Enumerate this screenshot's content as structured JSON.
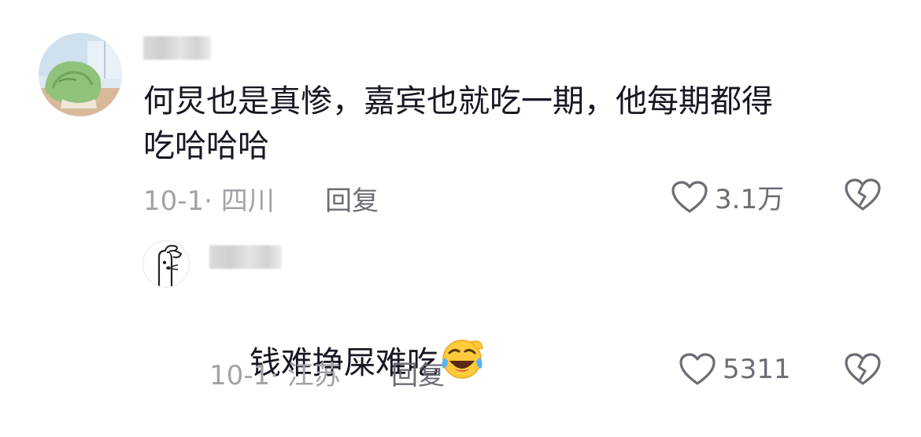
{
  "colors": {
    "text_primary": "#161823",
    "meta_gray": "#a1a3a8",
    "action_gray": "#6a6d74",
    "background": "#ffffff"
  },
  "comments": [
    {
      "avatar_icon": "anime-character-avatar",
      "text": "何炅也是真惨，嘉宾也就吃一期，他每期都得\n吃哈哈哈",
      "date": "10-1",
      "separator": "·",
      "location": "四川",
      "reply_label": "回复",
      "like_icon": "heart-outline-icon",
      "like_count": "3.1万",
      "dislike_icon": "broken-heart-icon"
    },
    {
      "avatar_icon": "cartoon-bunny-avatar",
      "text": "钱难挣屎难吃",
      "emoji_icon": "laughing-crying-emoji",
      "date": "10-1",
      "separator": "·",
      "location": "江苏",
      "reply_label": "回复",
      "like_icon": "heart-outline-icon",
      "like_count": "5311",
      "dislike_icon": "broken-heart-icon"
    }
  ]
}
